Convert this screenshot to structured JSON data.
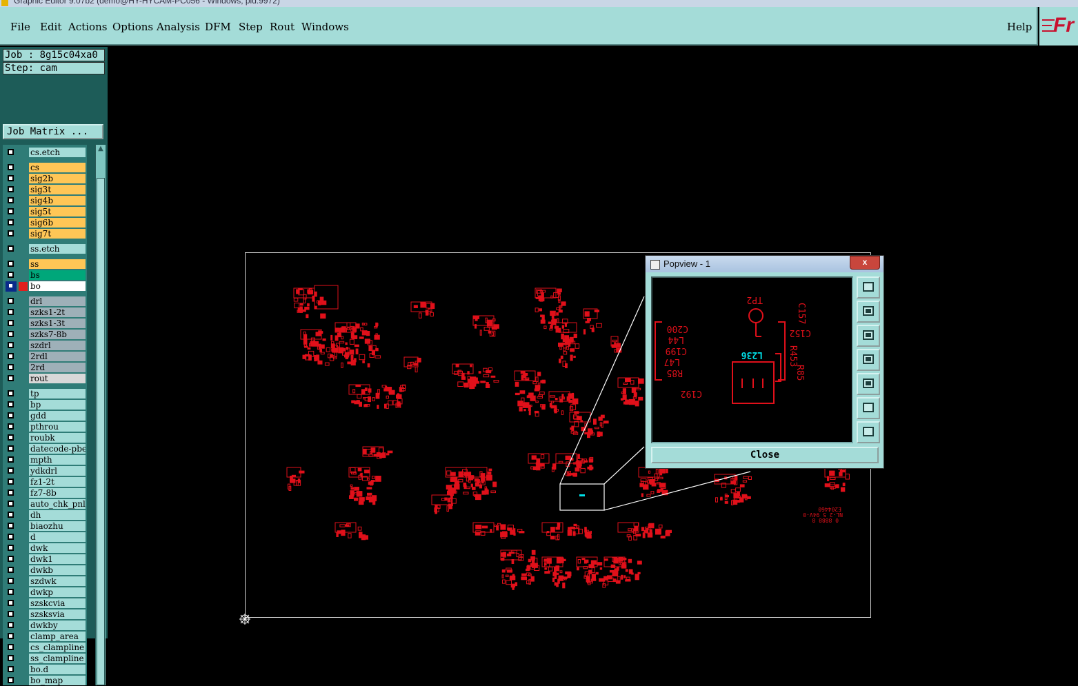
{
  "window": {
    "title": "Graphic Editor 9.07b2 (demo@HY-HYCAM-PC056 - Windows, pid:9972)"
  },
  "menu": {
    "items": [
      "File",
      "Edit",
      "Actions",
      "Options",
      "Analysis",
      "DFM",
      "Step",
      "Rout",
      "Windows"
    ],
    "help": "Help",
    "logo_text": "Fr"
  },
  "job": {
    "job_label": "Job : 8g15c04xa0",
    "step_label": "Step: cam",
    "matrix_button": "Job Matrix ..."
  },
  "layers": [
    {
      "name": "cs.etch",
      "color": "#a4dcd8"
    },
    {
      "name": "cs",
      "color": "#ffc656"
    },
    {
      "name": "sig2b",
      "color": "#ffc656"
    },
    {
      "name": "sig3t",
      "color": "#ffc656"
    },
    {
      "name": "sig4b",
      "color": "#ffc656"
    },
    {
      "name": "sig5t",
      "color": "#ffc656"
    },
    {
      "name": "sig6b",
      "color": "#ffc656"
    },
    {
      "name": "sig7t",
      "color": "#ffc656"
    },
    {
      "name": "ss.etch",
      "color": "#a4dcd8"
    },
    {
      "name": "ss",
      "color": "#ffc656"
    },
    {
      "name": "bs",
      "color": "#00a77a"
    },
    {
      "name": "bo",
      "color": "#ffffff"
    },
    {
      "name": "drl",
      "color": "#9eb0b8"
    },
    {
      "name": "szks1-2t",
      "color": "#9eb0b8"
    },
    {
      "name": "szks1-3t",
      "color": "#9eb0b8"
    },
    {
      "name": "szks7-8b",
      "color": "#9eb0b8"
    },
    {
      "name": "szdrl",
      "color": "#9eb0b8"
    },
    {
      "name": "2rdl",
      "color": "#9eb0b8"
    },
    {
      "name": "2rd",
      "color": "#9eb0b8"
    },
    {
      "name": "rout",
      "color": "#d8d8d8"
    },
    {
      "name": "tp",
      "color": "#a4dcd8"
    },
    {
      "name": "bp",
      "color": "#a4dcd8"
    },
    {
      "name": "gdd",
      "color": "#a4dcd8"
    },
    {
      "name": "pthrou",
      "color": "#a4dcd8"
    },
    {
      "name": "roubk",
      "color": "#a4dcd8"
    },
    {
      "name": "datecode-pbe",
      "color": "#a4dcd8"
    },
    {
      "name": "mpth",
      "color": "#a4dcd8"
    },
    {
      "name": "ydkdrl",
      "color": "#a4dcd8"
    },
    {
      "name": "fz1-2t",
      "color": "#a4dcd8"
    },
    {
      "name": "fz7-8b",
      "color": "#a4dcd8"
    },
    {
      "name": "auto_chk_pnl",
      "color": "#a4dcd8"
    },
    {
      "name": "dh",
      "color": "#a4dcd8"
    },
    {
      "name": "biaozhu",
      "color": "#a4dcd8"
    },
    {
      "name": "d",
      "color": "#a4dcd8"
    },
    {
      "name": "dwk",
      "color": "#a4dcd8"
    },
    {
      "name": "dwk1",
      "color": "#a4dcd8"
    },
    {
      "name": "dwkb",
      "color": "#a4dcd8"
    },
    {
      "name": "szdwk",
      "color": "#a4dcd8"
    },
    {
      "name": "dwkp",
      "color": "#a4dcd8"
    },
    {
      "name": "szskcvia",
      "color": "#a4dcd8"
    },
    {
      "name": "szsksvia",
      "color": "#a4dcd8"
    },
    {
      "name": "dwkby",
      "color": "#a4dcd8"
    },
    {
      "name": "clamp_area",
      "color": "#a4dcd8"
    },
    {
      "name": "cs_clampline",
      "color": "#a4dcd8"
    },
    {
      "name": "ss_clampline",
      "color": "#a4dcd8"
    },
    {
      "name": "bo.d",
      "color": "#a4dcd8"
    },
    {
      "name": "bo_map",
      "color": "#a4dcd8"
    }
  ],
  "board": {
    "color": "#e0101a",
    "marking_lines": [
      "E204460",
      "NL-2 5 94V-0",
      "0 8888 8"
    ]
  },
  "popview": {
    "title": "Popview - 1",
    "close_label": "Close",
    "window_close": "x",
    "labels": {
      "tp": "TP2",
      "c157": "C157",
      "c152": "C152",
      "c200": "C200",
      "l44": "L44",
      "c199": "C199",
      "l47": "L47",
      "r85": "R85",
      "l236": "L236",
      "c192": "C192",
      "r453": "R453",
      "r85b": "R85"
    },
    "highlight_color": "#00e0e8",
    "buttons": [
      "zoom-fit",
      "pan-up",
      "pan-down",
      "pan-left",
      "pan-right",
      "zoom-out",
      "zoom-in"
    ]
  }
}
